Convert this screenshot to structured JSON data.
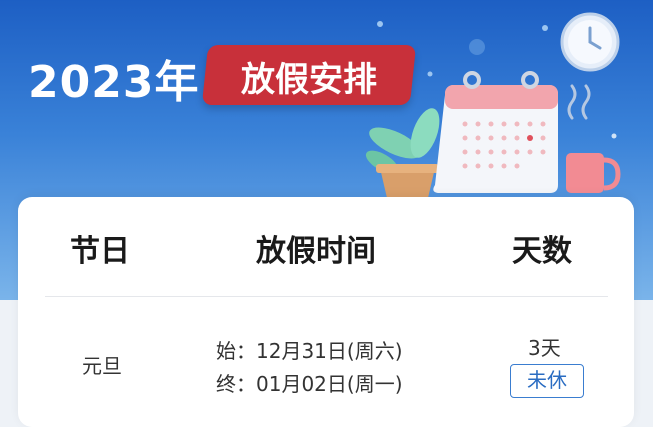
{
  "banner": {
    "year": "2023年",
    "tag": "放假安排"
  },
  "table": {
    "headers": {
      "holiday": "节日",
      "period": "放假时间",
      "days": "天数"
    },
    "rows": [
      {
        "holiday": "元旦",
        "start": "始：12月31日(周六)",
        "end": "终：01月02日(周一)",
        "days": "3天",
        "status": "未休"
      }
    ]
  },
  "colors": {
    "banner_top": "#1d5fc4",
    "banner_bottom": "#7ab4ea",
    "tag_red": "#c8303a",
    "status_blue": "#2a6cc2"
  }
}
